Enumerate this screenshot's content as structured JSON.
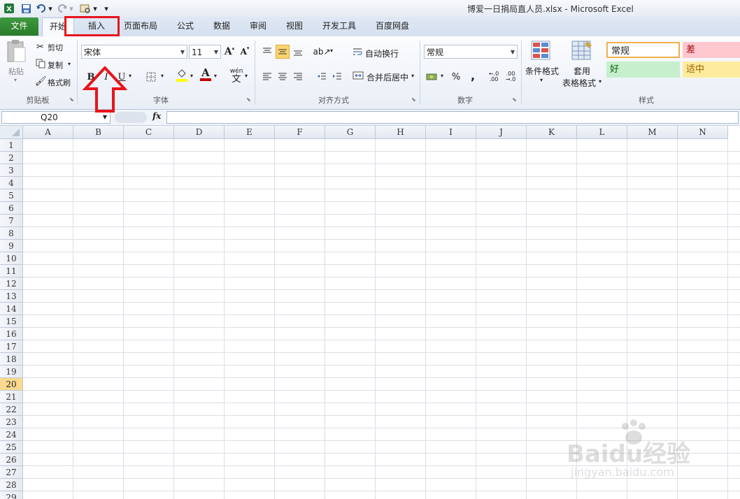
{
  "window": {
    "title": "博爱一日捐局直人员.xlsx  -  Microsoft Excel"
  },
  "quick_access": {
    "icons": [
      "excel-logo-icon",
      "save-icon",
      "undo-icon",
      "redo-icon",
      "print-preview-icon",
      "customize-icon"
    ]
  },
  "tabs": [
    {
      "id": "file",
      "label": "文件"
    },
    {
      "id": "home",
      "label": "开始"
    },
    {
      "id": "insert",
      "label": "插入"
    },
    {
      "id": "page_layout",
      "label": "页面布局"
    },
    {
      "id": "formulas",
      "label": "公式"
    },
    {
      "id": "data",
      "label": "数据"
    },
    {
      "id": "review",
      "label": "审阅"
    },
    {
      "id": "view",
      "label": "视图"
    },
    {
      "id": "developer",
      "label": "开发工具"
    },
    {
      "id": "baidu_drive",
      "label": "百度网盘"
    }
  ],
  "ribbon": {
    "clipboard": {
      "label": "剪贴板",
      "paste": "粘贴",
      "cut": "剪切",
      "copy": "复制",
      "format_painter": "格式刷"
    },
    "font": {
      "label": "字体",
      "font_name": "宋体",
      "font_size": "11",
      "grow": "A",
      "shrink": "A",
      "bold": "B",
      "italic": "I",
      "underline": "U",
      "font_color_letter": "A",
      "phonetic": "wén"
    },
    "alignment": {
      "label": "对齐方式",
      "wrap_text": "自动换行",
      "merge_center": "合并后居中"
    },
    "number": {
      "label": "数字",
      "format": "常规",
      "percent": "%",
      "comma": ","
    },
    "styles": {
      "label": "样式",
      "conditional_formatting": "条件格式",
      "format_as_table_line1": "套用",
      "format_as_table_line2": "表格格式",
      "cells": [
        {
          "label": "常规",
          "bg": "#ffffff",
          "color": "#000000"
        },
        {
          "label": "差",
          "bg": "#ffc7ce",
          "color": "#9c0006"
        },
        {
          "label": "好",
          "bg": "#c6efce",
          "color": "#006100"
        },
        {
          "label": "适中",
          "bg": "#ffeb9c",
          "color": "#9c6500"
        }
      ]
    }
  },
  "formula_bar": {
    "name_box": "Q20",
    "fx": "fx",
    "value": ""
  },
  "sheet": {
    "columns": [
      "A",
      "B",
      "C",
      "D",
      "E",
      "F",
      "G",
      "H",
      "I",
      "J",
      "K",
      "L",
      "M",
      "N"
    ],
    "rows": [
      "1",
      "2",
      "3",
      "4",
      "5",
      "6",
      "7",
      "8",
      "9",
      "10",
      "11",
      "12",
      "13",
      "14",
      "15",
      "16",
      "17",
      "18",
      "19",
      "20",
      "21",
      "22",
      "23",
      "24",
      "25",
      "26",
      "27",
      "28",
      "29"
    ],
    "active_row": "20"
  },
  "watermark": {
    "line1": "Baidu经验",
    "line2": "jingyan.baidu.com"
  },
  "colors": {
    "file_tab": "#2a7a2a",
    "annotation": "#e8141b",
    "active_row": "#f9d98d"
  }
}
